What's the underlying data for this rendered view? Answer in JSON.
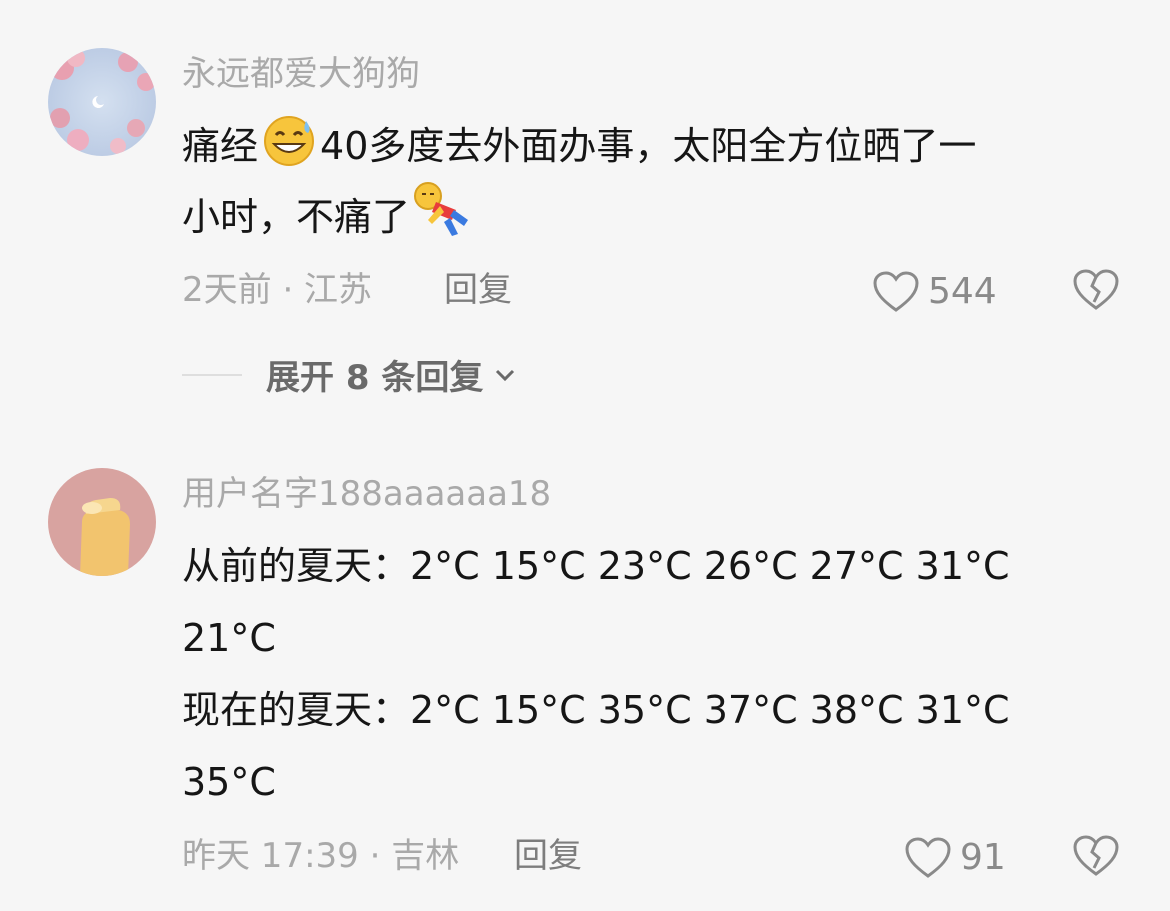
{
  "comments": [
    {
      "username": "永远都爱大狗狗",
      "text_parts": {
        "line1_a": "痛经",
        "line1_b": "40多度去外面办事，太阳全方位晒了一",
        "line2": "小时，不痛了"
      },
      "emojis": {
        "first": "grin-sweat-emoji",
        "second": "lying-person-emoji"
      },
      "meta": "2天前 · 江苏",
      "reply_label": "回复",
      "likes": "544",
      "expand_label": "展开 8 条回复"
    },
    {
      "username": "用户名字188aaaaaa18",
      "lines": [
        "从前的夏天：2°C 15°C 23°C 26°C 27°C 31°C",
        "21°C",
        "现在的夏天：2°C 15°C 35°C 37°C 38°C 31°C",
        "35°C"
      ],
      "meta": "昨天 17:39 · 吉林",
      "reply_label": "回复",
      "likes": "91"
    }
  ],
  "colors": {
    "background": "#f6f6f6",
    "muted": "#a9a9a9",
    "text": "#161616"
  }
}
